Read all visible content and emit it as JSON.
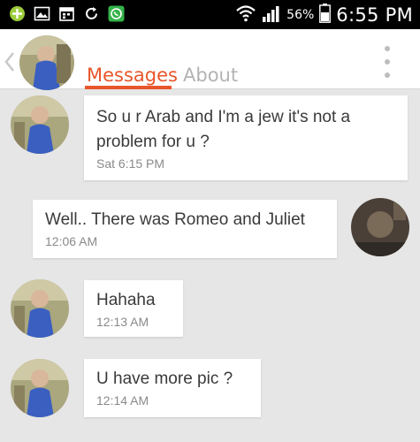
{
  "status_bar": {
    "battery_percent": "56%",
    "time": "6:55 PM",
    "icons": [
      "system-update-icon",
      "gallery-icon",
      "calendar-icon",
      "sync-icon",
      "whatsapp-icon",
      "wifi-icon",
      "signal-icon",
      "battery-icon"
    ]
  },
  "header": {
    "tabs": [
      {
        "label": "Messages",
        "active": true
      },
      {
        "label": "About",
        "active": false
      }
    ],
    "accent_color": "#e8562a"
  },
  "messages": [
    {
      "text": "So u r Arab and I'm a jew it's not a problem for u ?",
      "time": "Sat 6:15 PM",
      "side": "left"
    },
    {
      "text": "Well.. There was Romeo and Juliet",
      "time": "12:06 AM",
      "side": "right"
    },
    {
      "text": "Hahaha",
      "time": "12:13 AM",
      "side": "left"
    },
    {
      "text": "U have more pic ?",
      "time": "12:14 AM",
      "side": "left"
    }
  ]
}
